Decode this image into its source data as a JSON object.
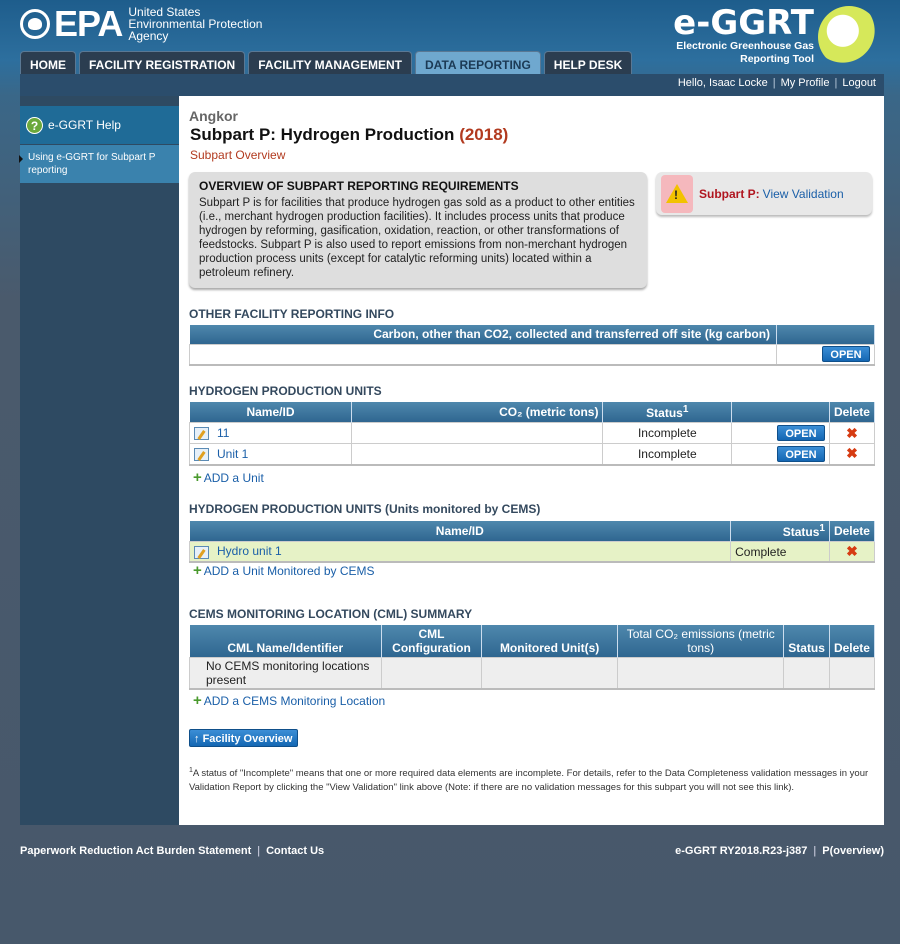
{
  "header": {
    "agency_logo_text": "EPA",
    "agency_name_line1": "United States",
    "agency_name_line2": "Environmental Protection",
    "agency_name_line3": "Agency",
    "brand_title": "e-GGRT",
    "brand_sub_line1": "Electronic Greenhouse Gas",
    "brand_sub_line2": "Reporting Tool",
    "tabs": [
      {
        "label": "HOME",
        "active": false
      },
      {
        "label": "FACILITY REGISTRATION",
        "active": false
      },
      {
        "label": "FACILITY MANAGEMENT",
        "active": false
      },
      {
        "label": "DATA REPORTING",
        "active": true
      },
      {
        "label": "HELP DESK",
        "active": false
      }
    ],
    "user": {
      "greeting": "Hello, Isaac Locke",
      "profile": "My Profile",
      "logout": "Logout"
    }
  },
  "sidebar": {
    "help_title": "e-GGRT Help",
    "help_icon": "question-icon",
    "link": "Using e-GGRT for Subpart P reporting"
  },
  "page": {
    "facility": "Angkor",
    "title": "Subpart P: Hydrogen Production",
    "year": "(2018)",
    "subtitle": "Subpart Overview"
  },
  "overview": {
    "heading": "OVERVIEW OF SUBPART REPORTING REQUIREMENTS",
    "text": "Subpart P is for facilities that produce hydrogen gas sold as a product to other entities (i.e., merchant hydrogen production facilities). It includes process units that produce hydrogen by reforming, gasification, oxidation, reaction, or other transformations of feedstocks. Subpart P is also used to report emissions from non-merchant hydrogen production process units (except for catalytic reforming units) located within a petroleum refinery."
  },
  "validation": {
    "label": "Subpart P:",
    "link": "View Validation",
    "icon": "warning-icon"
  },
  "other_info": {
    "title": "OTHER FACILITY REPORTING INFO",
    "header": "Carbon, other than CO2, collected and transferred off site (kg carbon)",
    "open_label": "OPEN"
  },
  "hpu": {
    "title": "HYDROGEN PRODUCTION UNITS",
    "columns": {
      "name": "Name/ID",
      "co2": "CO₂ (metric tons)",
      "status": "Status",
      "status_sup": "1",
      "delete": "Delete"
    },
    "rows": [
      {
        "name": "11",
        "co2": "",
        "status": "Incomplete",
        "open": "OPEN"
      },
      {
        "name": "Unit 1",
        "co2": "",
        "status": "Incomplete",
        "open": "OPEN"
      }
    ],
    "add_label": "ADD a Unit"
  },
  "cems_units": {
    "title": "HYDROGEN PRODUCTION UNITS (Units monitored by CEMS)",
    "columns": {
      "name": "Name/ID",
      "status": "Status",
      "status_sup": "1",
      "delete": "Delete"
    },
    "rows": [
      {
        "name": "Hydro unit 1",
        "status": "Complete"
      }
    ],
    "add_label": "ADD a Unit Monitored by CEMS"
  },
  "cml": {
    "title": "CEMS MONITORING LOCATION (CML) SUMMARY",
    "columns": {
      "name": "CML Name/Identifier",
      "config": "CML Configuration",
      "units": "Monitored Unit(s)",
      "total": "Total CO₂ emissions (metric tons)",
      "status": "Status",
      "delete": "Delete"
    },
    "empty_text": "No CEMS monitoring locations present",
    "add_label": "ADD a CEMS Monitoring Location"
  },
  "facility_overview_button": "Facility Overview",
  "footnote": {
    "sup": "1",
    "text": "A status of \"Incomplete\" means that one or more required data elements are incomplete. For details, refer to the Data Completeness validation messages in your Validation Report by clicking the \"View Validation\" link above (Note: if there are no validation messages for this subpart you will not see this link)."
  },
  "footer": {
    "paperwork": "Paperwork Reduction Act Burden Statement",
    "contact": "Contact Us",
    "version": "e-GGRT RY2018.R23-j387",
    "page_code": "P(overview)"
  },
  "colors": {
    "accent": "#2f6690",
    "title_red": "#b23a1f",
    "complete_row": "#e6f2c6"
  }
}
